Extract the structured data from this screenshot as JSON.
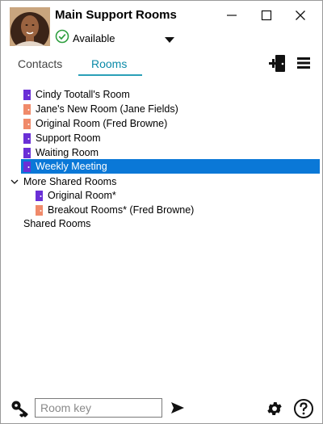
{
  "header": {
    "title": "Main Support Rooms",
    "status": "Available"
  },
  "tabs": [
    {
      "label": "Contacts"
    },
    {
      "label": "Rooms"
    }
  ],
  "rooms": [
    {
      "label": "Cindy Tootall's Room",
      "color": "#6a2fd6"
    },
    {
      "label": "Jane's New Room (Jane Fields)",
      "color": "#f08a6a"
    },
    {
      "label": "Original Room (Fred Browne)",
      "color": "#f08a6a"
    },
    {
      "label": "Support Room",
      "color": "#6a2fd6"
    },
    {
      "label": "Waiting Room",
      "color": "#6a2fd6"
    },
    {
      "label": "Weekly Meeting",
      "color": "#6a2fd6"
    }
  ],
  "more_shared": {
    "label": "More Shared Rooms",
    "items": [
      {
        "label": "Original Room*",
        "color": "#6a2fd6"
      },
      {
        "label": "Breakout Rooms* (Fred Browne)",
        "color": "#f08a6a"
      }
    ]
  },
  "shared_rooms_label": "Shared Rooms",
  "footer": {
    "room_key_placeholder": "Room key"
  },
  "colors": {
    "accent": "#0a8aa8",
    "selection": "#0a78d7",
    "status_ok": "#2e9e3e"
  }
}
